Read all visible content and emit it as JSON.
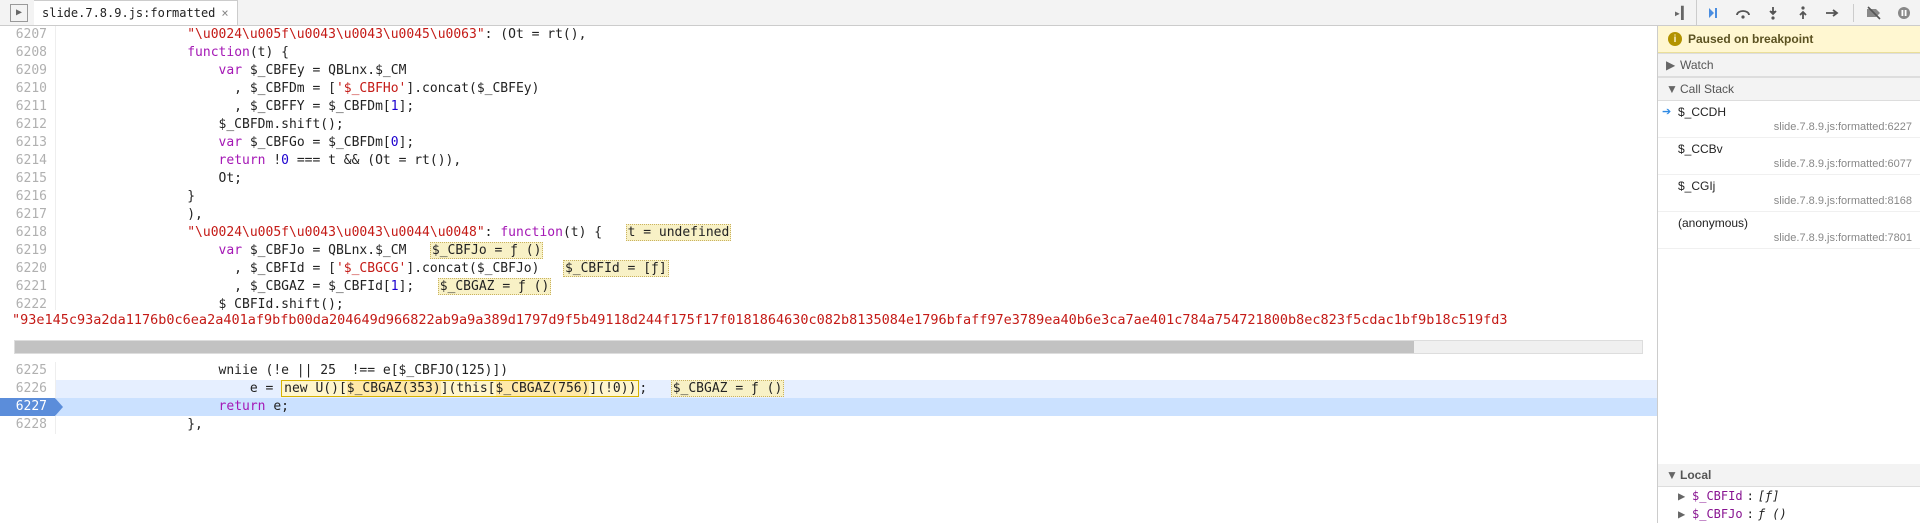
{
  "tabs": [
    {
      "title": "slide.7.8.9.js:formatted"
    }
  ],
  "debugger": {
    "paused_banner": "Paused on breakpoint",
    "watch_label": "Watch",
    "callstack_label": "Call Stack",
    "local_label": "Local",
    "stack": [
      {
        "fn": "$_CCDH",
        "loc": "slide.7.8.9.js:formatted:6227"
      },
      {
        "fn": "$_CCBv",
        "loc": "slide.7.8.9.js:formatted:6077"
      },
      {
        "fn": "$_CGIj",
        "loc": "slide.7.8.9.js:formatted:8168"
      },
      {
        "fn": "(anonymous)",
        "loc": "slide.7.8.9.js:formatted:7801"
      }
    ],
    "locals": [
      {
        "key": "$_CBFId",
        "val": "[ƒ]"
      },
      {
        "key": "$_CBFJo",
        "val": "ƒ ()"
      }
    ]
  },
  "long_string": "\"93e145c93a2da1176b0c6ea2a401af9bfb00da204649d966822ab9a9a389d1797d9f5b49118d244f175f17f0181864630c082b8135084e1796bfaff97e3789ea40b6e3ca7ae401c784a754721800b8ec823f5cdac1bf9b18c519fd3",
  "editor_lines": [
    {
      "n": 6207,
      "html": "                <span class='str'>\"\\u0024\\u005f\\u0043\\u0043\\u0045\\u0063\"</span>: (Ot = rt(),"
    },
    {
      "n": 6208,
      "html": "                <span class='kw'>function</span>(t) {"
    },
    {
      "n": 6209,
      "html": "                    <span class='kw'>var</span> $_CBFEy = QBLnx.$_CM"
    },
    {
      "n": 6210,
      "html": "                      , $_CBFDm = [<span class='str'>'$_CBFHo'</span>].concat($_CBFEy)"
    },
    {
      "n": 6211,
      "html": "                      , $_CBFFY = $_CBFDm[<span class='num'>1</span>];"
    },
    {
      "n": 6212,
      "html": "                    $_CBFDm.shift();"
    },
    {
      "n": 6213,
      "html": "                    <span class='kw'>var</span> $_CBFGo = $_CBFDm[<span class='num'>0</span>];"
    },
    {
      "n": 6214,
      "html": "                    <span class='kw'>return</span> !<span class='num'>0</span> === t && (Ot = rt()),"
    },
    {
      "n": 6215,
      "html": "                    Ot;"
    },
    {
      "n": 6216,
      "html": "                }"
    },
    {
      "n": 6217,
      "html": "                ),"
    },
    {
      "n": 6218,
      "html": "                <span class='str'>\"\\u0024\\u005f\\u0043\\u0043\\u0044\\u0048\"</span>: <span class='kw'>function</span>(t) {   <span class='tokhl'>t = undefined</span>"
    },
    {
      "n": 6219,
      "html": "                    <span class='kw'>var</span> $_CBFJo = QBLnx.$_CM   <span class='tokhl'>$_CBFJo = ƒ ()</span>"
    },
    {
      "n": 6220,
      "html": "                      , $_CBFId = [<span class='str'>'$_CBGCG'</span>].concat($_CBFJo)   <span class='tokhl'>$_CBFId = [ƒ]</span>"
    },
    {
      "n": 6221,
      "html": "                      , $_CBGAZ = $_CBFId[<span class='num'>1</span>];   <span class='tokhl'>$_CBGAZ = ƒ ()</span>"
    },
    {
      "n": 6222,
      "html": "                    $ CBFId.shift();"
    }
  ],
  "editor_lines_bottom": [
    {
      "n": 6225,
      "html": "                    wniie (!e || 25  !== e[$_CBFJO(125)])",
      "cls": ""
    },
    {
      "n": 6226,
      "html": "                        e = <span class='newhl'>new U()[<span class='tokhl2'>$_CBGAZ(353)</span>](this[<span class='tokhl2'>$_CBGAZ(756)</span>](!0))</span>;   <span class='tokhl'>$_CBGAZ = ƒ ()</span>",
      "cls": "hl-6226"
    },
    {
      "n": 6227,
      "html": "                    <span class='kw'>return</span> e;",
      "cls": "execline"
    },
    {
      "n": 6228,
      "html": "                },",
      "cls": ""
    }
  ]
}
